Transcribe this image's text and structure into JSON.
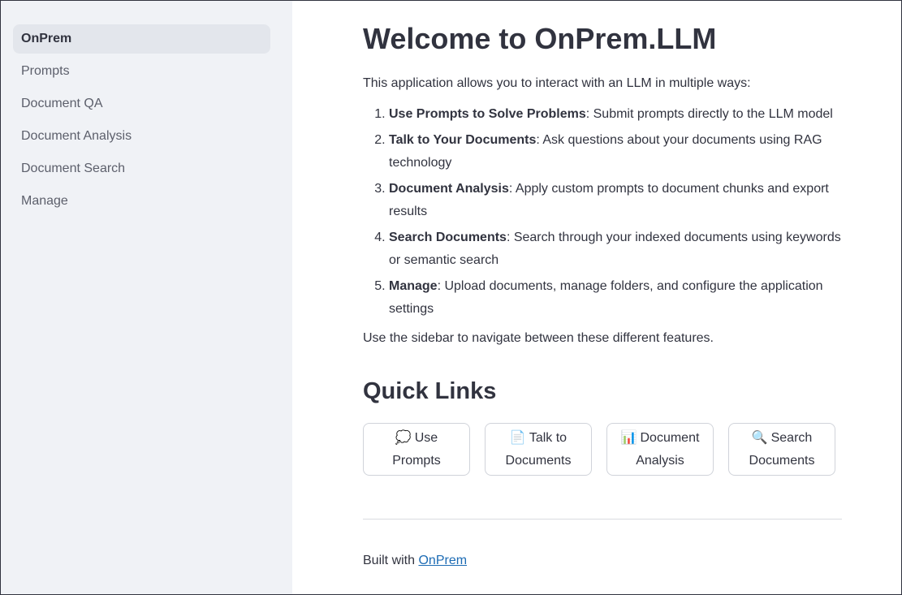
{
  "sidebar": {
    "items": [
      {
        "label": "OnPrem",
        "active": true
      },
      {
        "label": "Prompts"
      },
      {
        "label": "Document QA"
      },
      {
        "label": "Document Analysis"
      },
      {
        "label": "Document Search"
      },
      {
        "label": "Manage"
      }
    ]
  },
  "main": {
    "title": "Welcome to OnPrem.LLM",
    "intro": "This application allows you to interact with an LLM in multiple ways:",
    "features": [
      {
        "num": "1.",
        "name": "Use Prompts to Solve Problems",
        "desc": ": Submit prompts directly to the LLM model"
      },
      {
        "num": "2.",
        "name": "Talk to Your Documents",
        "desc": ": Ask questions about your documents using RAG technology"
      },
      {
        "num": "3.",
        "name": "Document Analysis",
        "desc": ": Apply custom prompts to document chunks and export results"
      },
      {
        "num": "4.",
        "name": "Search Documents",
        "desc": ": Search through your indexed documents using keywords or semantic search"
      },
      {
        "num": "5.",
        "name": "Manage",
        "desc": ": Upload documents, manage folders, and configure the application settings"
      }
    ],
    "outro": "Use the sidebar to navigate between these different features.",
    "quick_links_title": "Quick Links",
    "quick_links": [
      {
        "icon": "speech-bubble-icon",
        "glyph": "💭",
        "line1": "Use",
        "line2": "Prompts"
      },
      {
        "icon": "document-icon",
        "glyph": "📄",
        "line1": "Talk to",
        "line2": "Documents"
      },
      {
        "icon": "bar-chart-icon",
        "glyph": "📊",
        "line1": "Document",
        "line2": "Analysis"
      },
      {
        "icon": "magnifier-icon",
        "glyph": "🔍",
        "line1": "Search",
        "line2": "Documents"
      }
    ],
    "footer_prefix": "Built with ",
    "footer_link": "OnPrem"
  }
}
